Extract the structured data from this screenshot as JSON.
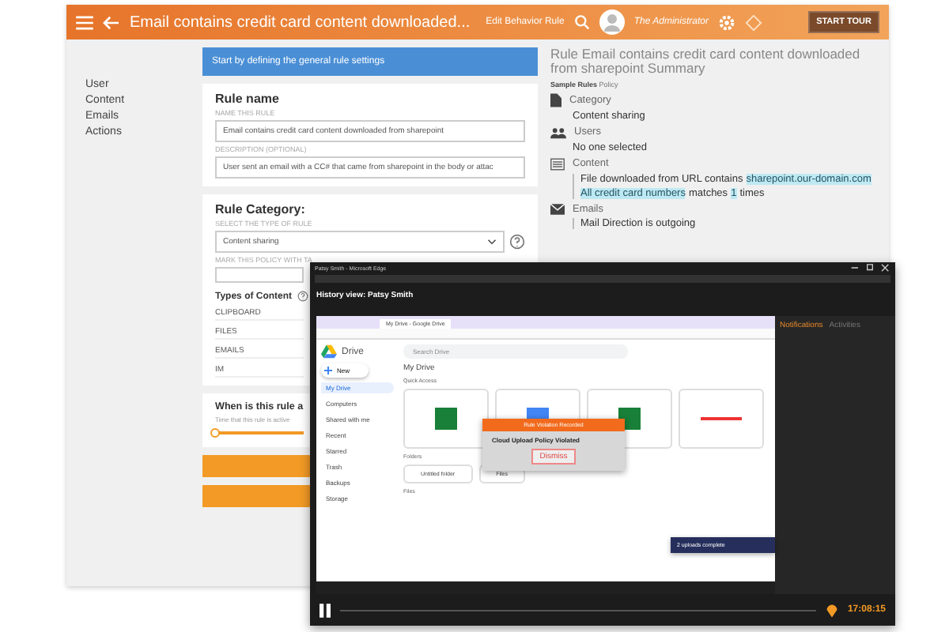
{
  "header": {
    "title": "Email contains credit card content downloaded...",
    "subtitle": "Edit Behavior Rule",
    "user": "The Administrator",
    "tour_button": "START TOUR"
  },
  "nav": [
    "User",
    "Content",
    "Emails",
    "Actions"
  ],
  "banner": "Start by defining the general rule settings",
  "rule_name": {
    "heading": "Rule name",
    "name_label": "NAME THIS RULE",
    "name_value": "Email contains credit card content downloaded from sharepoint",
    "description_label": "DESCRIPTION (OPTIONAL)",
    "description_value": "User sent an email with a CC# that came from sharepoint in the body or attac"
  },
  "rule_category": {
    "heading": "Rule Category:",
    "type_label": "SELECT THE TYPE OF RULE",
    "type_value": "Content sharing",
    "tag_label": "MARK THIS POLICY WITH TA",
    "content_heading": "Types of Content",
    "content_types": [
      "CLIPBOARD",
      "FILES",
      "EMAILS",
      "IM"
    ]
  },
  "schedule": {
    "heading": "When is this rule a",
    "hint": "Time that this rule is active",
    "level": 0
  },
  "summary": {
    "title": "Rule Email contains credit card content downloaded from sharepoint Summary",
    "source": "Sample Rules",
    "source_suffix": "Policy",
    "sections": [
      {
        "kind": "value",
        "title": "Category",
        "value": "Content sharing"
      },
      {
        "kind": "value",
        "title": "Users",
        "value": "No one selected"
      },
      {
        "kind": "conditions",
        "title": "Content",
        "lines": [
          [
            {
              "text": "File downloaded from URL contains",
              "highlight": false
            },
            {
              "text": "sharepoint.our-domain.com",
              "highlight": true
            }
          ],
          [
            {
              "text": "All credit card numbers",
              "highlight": true
            },
            {
              "text": "matches",
              "highlight": false
            },
            {
              "text": "1",
              "highlight": true
            },
            {
              "text": "times",
              "highlight": false
            }
          ]
        ]
      },
      {
        "kind": "conditions",
        "title": "Emails",
        "lines": [
          [
            {
              "text": "Mail Direction is outgoing",
              "highlight": false
            }
          ]
        ]
      }
    ]
  },
  "recording": {
    "window_title": "Patsy Smith - Microsoft Edge",
    "history_title": "History view: Patsy Smith",
    "browser_tab": "My Drive - Google Drive",
    "drive_name": "Drive",
    "search_placeholder": "Search Drive",
    "location": "My Drive",
    "new_button": "New",
    "drive_nav": [
      {
        "label": "My Drive",
        "selected": true
      },
      {
        "label": "Computers",
        "selected": false
      },
      {
        "label": "Shared with me",
        "selected": false
      },
      {
        "label": "Recent",
        "selected": false
      },
      {
        "label": "Starred",
        "selected": false
      },
      {
        "label": "Trash",
        "selected": false
      },
      {
        "label": "Backups",
        "selected": false
      },
      {
        "label": "Storage",
        "selected": false
      }
    ],
    "quick_access": "Quick Access",
    "folders_heading": "Folders",
    "folders": [
      "Untitled folder",
      "Files"
    ],
    "files_heading": "Files",
    "popup": {
      "header": "Rule Violation Recorded",
      "title": "Cloud Upload Policy Violated",
      "button": "Dismiss"
    },
    "uploads": "2 uploads complete",
    "tabs": [
      {
        "label": "Notifications",
        "selected": true
      },
      {
        "label": "Activities",
        "selected": false
      }
    ],
    "clock": "17:08:15"
  }
}
